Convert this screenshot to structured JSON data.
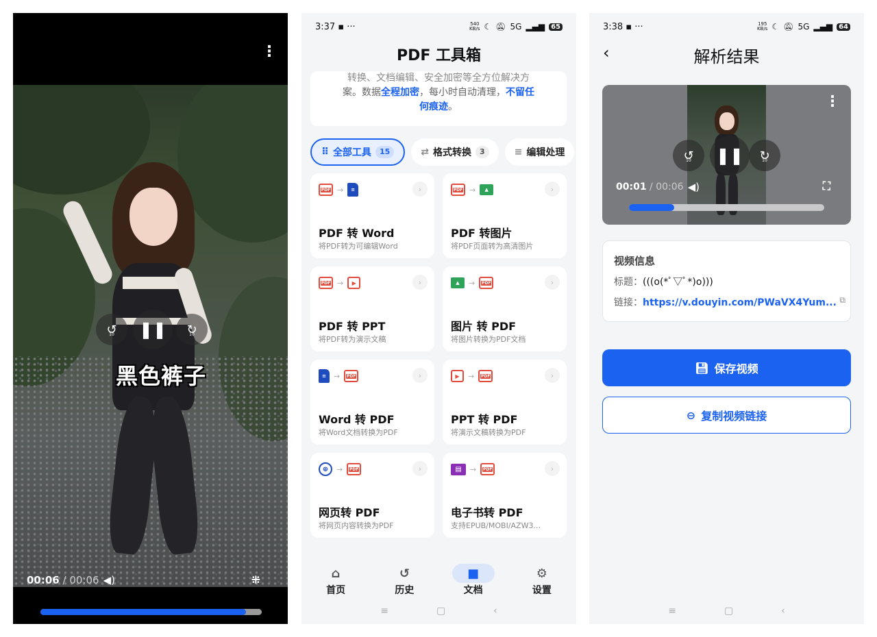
{
  "panel1": {
    "subtitle": "黑色裤子",
    "time_current": "00:06",
    "time_sep": " / ",
    "time_total": "00:06",
    "progress": 0.93,
    "rewind_label": "10",
    "forward_label": "10"
  },
  "panel2": {
    "status": {
      "time": "3:37",
      "speed_top": "540",
      "speed_bottom": "KB/s",
      "network": "5G",
      "battery": "65"
    },
    "title": "PDF 工具箱",
    "intro": {
      "line1": "转换、文档编辑、安全加密等全方位解决方",
      "line2a": "案。数据",
      "line2b": "全程加密",
      "line2c": "，每小时自动清理，",
      "line2d": "不留任",
      "line3a": "何痕迹",
      "line3b": "。"
    },
    "chips": [
      {
        "label": "全部工具",
        "count": "15"
      },
      {
        "label": "格式转换",
        "count": "3"
      },
      {
        "label": "编辑处理",
        "count": ""
      }
    ],
    "tools": [
      {
        "name": "PDF 转 Word",
        "desc": "将PDF转为可编辑Word"
      },
      {
        "name": "PDF 转图片",
        "desc": "将PDF页面转为高清图片"
      },
      {
        "name": "PDF 转 PPT",
        "desc": "将PDF转为演示文稿"
      },
      {
        "name": "图片 转 PDF",
        "desc": "将图片转换为PDF文档"
      },
      {
        "name": "Word 转 PDF",
        "desc": "将Word文档转换为PDF"
      },
      {
        "name": "PPT 转 PDF",
        "desc": "将演示文稿转换为PDF"
      },
      {
        "name": "网页转 PDF",
        "desc": "将网页内容转换为PDF"
      },
      {
        "name": "电子书转 PDF",
        "desc": "支持EPUB/MOBI/AZW3..."
      }
    ],
    "pdf_tag": "PDF",
    "tabs": [
      {
        "label": "首页"
      },
      {
        "label": "历史"
      },
      {
        "label": "文档"
      },
      {
        "label": "设置"
      }
    ]
  },
  "panel3": {
    "status": {
      "time": "3:38",
      "speed_top": "195",
      "speed_bottom": "KB/s",
      "network": "5G",
      "battery": "64"
    },
    "title": "解析结果",
    "player": {
      "time_current": "00:01",
      "time_sep": " / ",
      "time_total": "00:06",
      "progress": 0.23,
      "rewind_label": "10",
      "forward_label": "10"
    },
    "info": {
      "heading": "视频信息",
      "title_label": "标题：",
      "title_value": "(((o(*ﾟ▽ﾟ*)o)))",
      "link_label": "链接：",
      "link_value": "https://v.douyin.com/PWaVX4Yum..."
    },
    "save_button": "保存视频",
    "copy_button": "复制视频链接"
  },
  "colors": {
    "accent": "#1b62f0",
    "pdf_red": "#e24a3b"
  }
}
